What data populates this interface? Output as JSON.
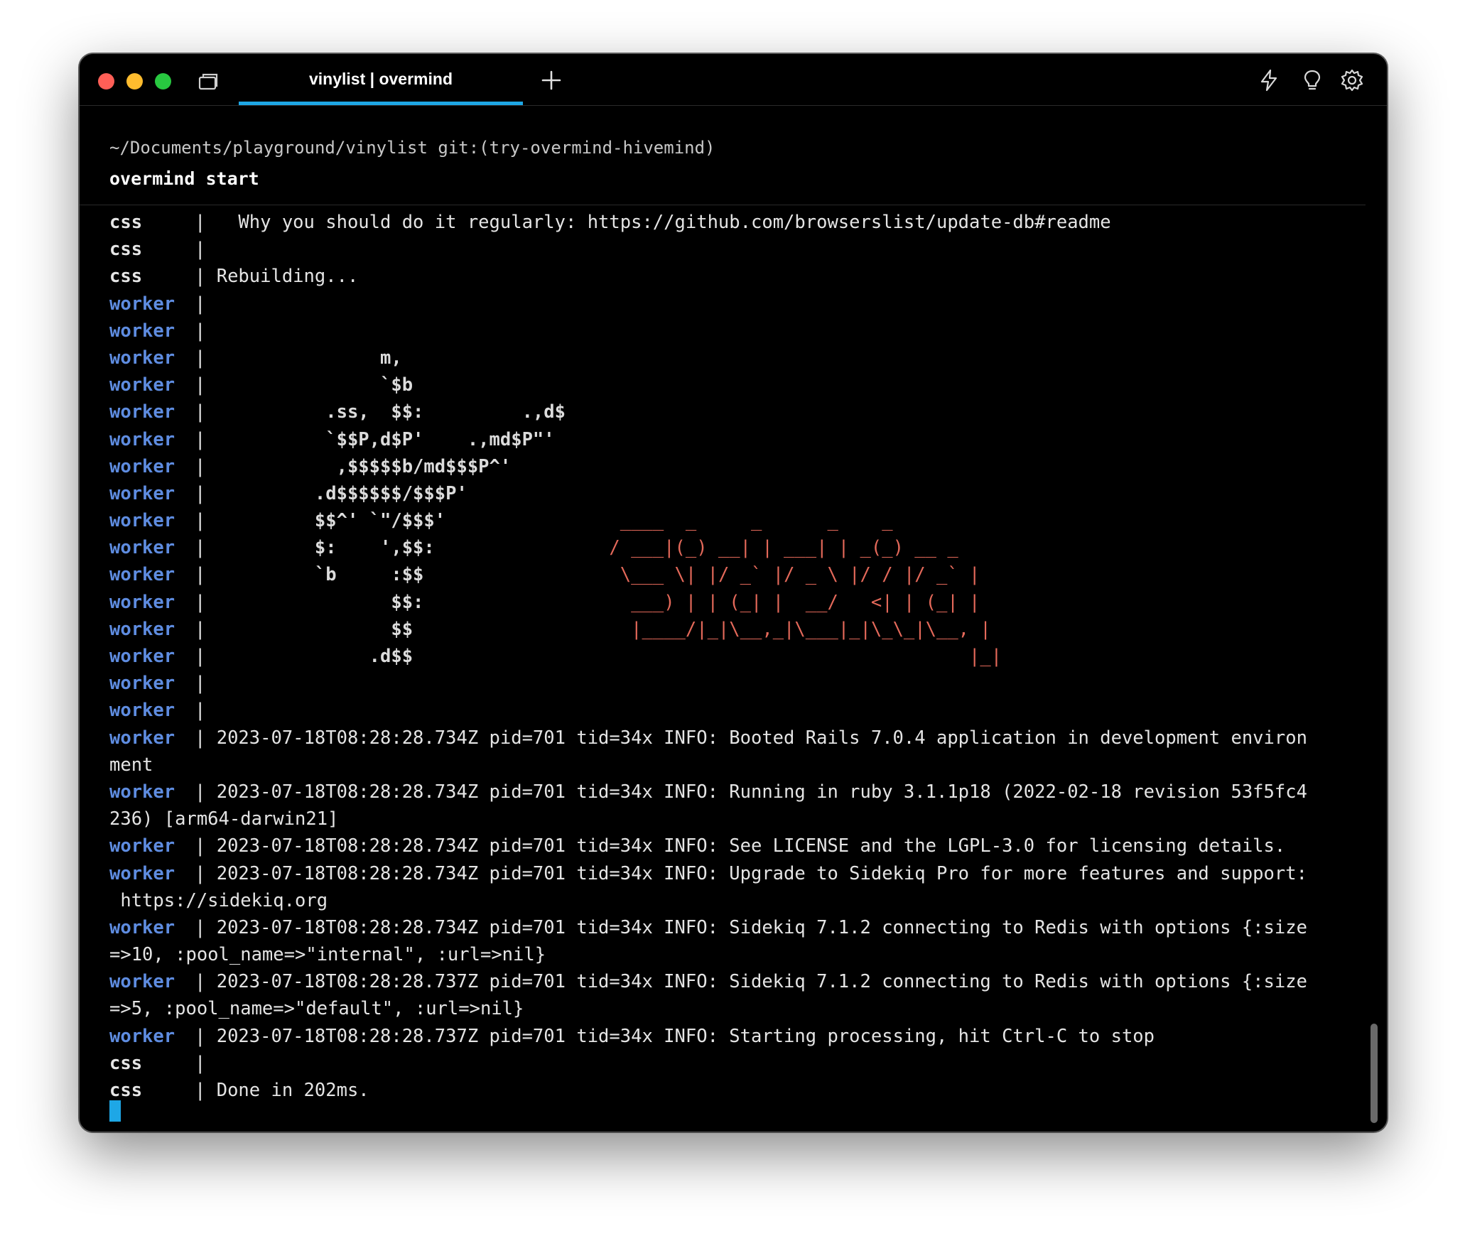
{
  "window": {
    "tab_title": "vinylist | overmind",
    "accent_color": "#1ea7e6"
  },
  "icons": {
    "close": "close-traffic-light",
    "minimize": "minimize-traffic-light",
    "zoom": "zoom-traffic-light",
    "tabs": "tabs-overview-icon",
    "new_tab": "plus-icon",
    "bolt": "lightning-bolt-icon",
    "bulb": "lightbulb-icon",
    "gear": "gear-icon"
  },
  "prompt": {
    "path": "~/Documents/playground/vinylist git:(try-overmind-hivemind)",
    "command": "overmind start"
  },
  "colors": {
    "css_label": "#e6e6e6",
    "worker_label": "#5e8ce0",
    "sidekiq_logo": "#e4695a"
  },
  "lines": [
    {
      "proc": "css",
      "sep": "|",
      "text": "  Why you should do it regularly: https://github.com/browserslist/update-db#readme"
    },
    {
      "proc": "css",
      "sep": "|",
      "text": ""
    },
    {
      "proc": "css",
      "sep": "|",
      "text": "Rebuilding..."
    },
    {
      "proc": "worker",
      "sep": "|",
      "text": ""
    },
    {
      "proc": "worker",
      "sep": "|",
      "text": ""
    },
    {
      "proc": "worker",
      "sep": "|",
      "art": "               m,",
      "logo": ""
    },
    {
      "proc": "worker",
      "sep": "|",
      "art": "               `$b",
      "logo": ""
    },
    {
      "proc": "worker",
      "sep": "|",
      "art": "          .ss,  $$:         .,d$",
      "logo": ""
    },
    {
      "proc": "worker",
      "sep": "|",
      "art": "          `$$P,d$P'    .,md$P\"'",
      "logo": ""
    },
    {
      "proc": "worker",
      "sep": "|",
      "art": "           ,$$$$$b/md$$$P^'",
      "logo": ""
    },
    {
      "proc": "worker",
      "sep": "|",
      "art": "         .d$$$$$$/$$$P'",
      "logo": ""
    },
    {
      "proc": "worker",
      "sep": "|",
      "art": "         $$^' `\"/$$$'",
      "logo": "       ____  _     _      _    _"
    },
    {
      "proc": "worker",
      "sep": "|",
      "art": "         $:    ',$$:",
      "logo": "      / ___|(_) __| | ___| | _(_) __ _"
    },
    {
      "proc": "worker",
      "sep": "|",
      "art": "         `b     :$$",
      "logo": "       \\___ \\| |/ _` |/ _ \\ |/ / |/ _` |"
    },
    {
      "proc": "worker",
      "sep": "|",
      "art": "                $$:",
      "logo": "        ___) | | (_| |  __/   <| | (_| |"
    },
    {
      "proc": "worker",
      "sep": "|",
      "art": "                $$",
      "logo": "        |____/|_|\\__,_|\\___|_|\\_\\_|\\__, |"
    },
    {
      "proc": "worker",
      "sep": "|",
      "art": "              .d$$",
      "logo": "                                       |_|"
    },
    {
      "proc": "worker",
      "sep": "|",
      "text": ""
    },
    {
      "proc": "worker",
      "sep": "|",
      "text": ""
    },
    {
      "proc": "worker",
      "sep": "|",
      "text": "2023-07-18T08:28:28.734Z pid=701 tid=34x INFO: Booted Rails 7.0.4 application in development environ"
    },
    {
      "proc": "",
      "sep": "",
      "text": "ment"
    },
    {
      "proc": "worker",
      "sep": "|",
      "text": "2023-07-18T08:28:28.734Z pid=701 tid=34x INFO: Running in ruby 3.1.1p18 (2022-02-18 revision 53f5fc4"
    },
    {
      "proc": "",
      "sep": "",
      "text": "236) [arm64-darwin21]"
    },
    {
      "proc": "worker",
      "sep": "|",
      "text": "2023-07-18T08:28:28.734Z pid=701 tid=34x INFO: See LICENSE and the LGPL-3.0 for licensing details."
    },
    {
      "proc": "worker",
      "sep": "|",
      "text": "2023-07-18T08:28:28.734Z pid=701 tid=34x INFO: Upgrade to Sidekiq Pro for more features and support:"
    },
    {
      "proc": "",
      "sep": "",
      "text": " https://sidekiq.org"
    },
    {
      "proc": "worker",
      "sep": "|",
      "text": "2023-07-18T08:28:28.734Z pid=701 tid=34x INFO: Sidekiq 7.1.2 connecting to Redis with options {:size"
    },
    {
      "proc": "",
      "sep": "",
      "text": "=>10, :pool_name=>\"internal\", :url=>nil}"
    },
    {
      "proc": "worker",
      "sep": "|",
      "text": "2023-07-18T08:28:28.737Z pid=701 tid=34x INFO: Sidekiq 7.1.2 connecting to Redis with options {:size"
    },
    {
      "proc": "",
      "sep": "",
      "text": "=>5, :pool_name=>\"default\", :url=>nil}"
    },
    {
      "proc": "worker",
      "sep": "|",
      "text": "2023-07-18T08:28:28.737Z pid=701 tid=34x INFO: Starting processing, hit Ctrl-C to stop"
    },
    {
      "proc": "css",
      "sep": "|",
      "text": ""
    },
    {
      "proc": "css",
      "sep": "|",
      "text": "Done in 202ms."
    }
  ]
}
